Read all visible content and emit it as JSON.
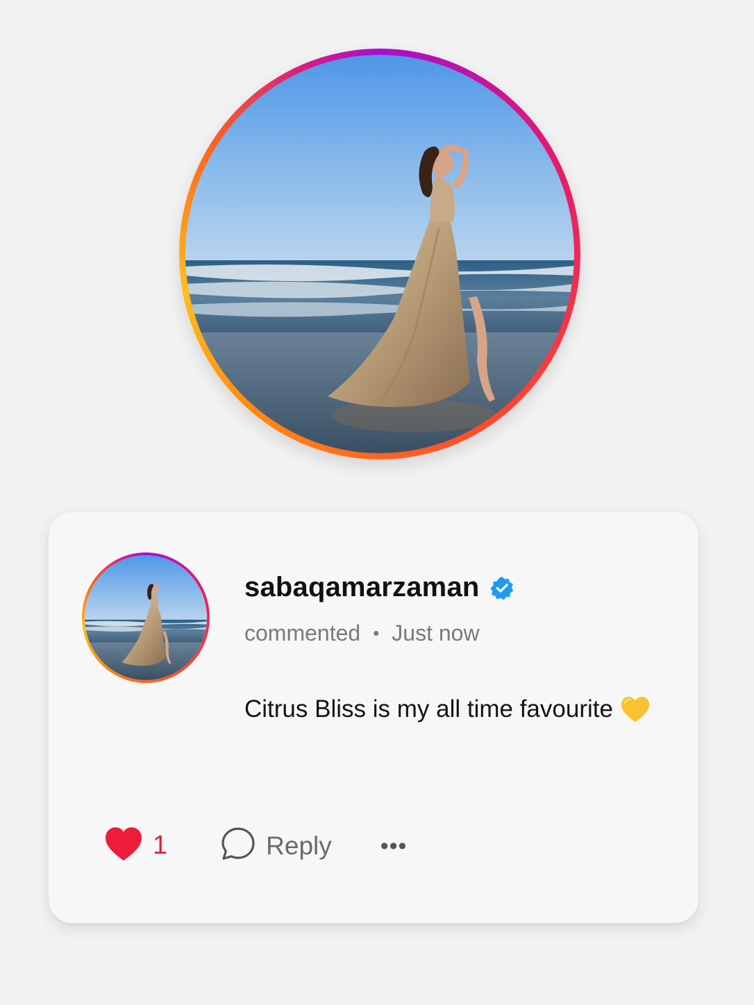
{
  "profile": {
    "username": "sabaqamarzaman",
    "verified": true,
    "photo": "woman-in-gold-gown-at-beach"
  },
  "comment": {
    "action_text": "commented",
    "separator": "•",
    "timestamp": "Just now",
    "text": "Citrus Bliss is my all time favourite",
    "emoji": "yellow-heart"
  },
  "actions": {
    "like_icon": "heart-filled-icon",
    "like_count": "1",
    "reply_icon": "speech-bubble-icon",
    "reply_label": "Reply",
    "more_icon": "more-horizontal-icon",
    "more_label": "•••"
  },
  "colors": {
    "like_red": "#ee1c3b",
    "verified_blue": "#1d9bf0",
    "ring_gradient": [
      "#a60fcc",
      "#e21a6f",
      "#ff8a10",
      "#ffbf1e"
    ]
  }
}
